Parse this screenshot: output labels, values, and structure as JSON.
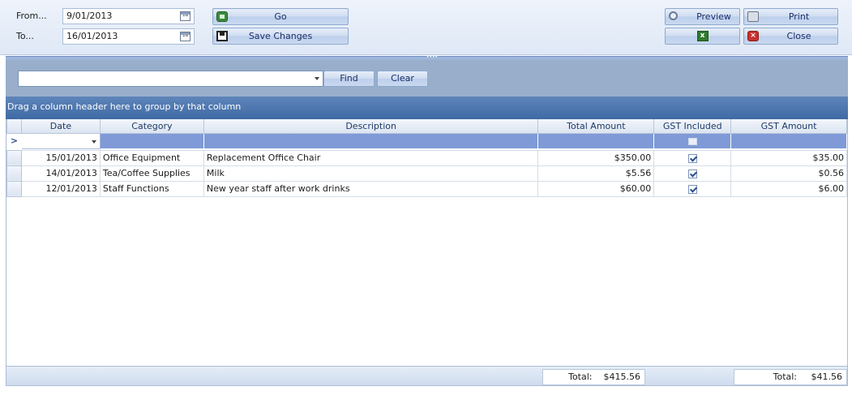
{
  "toolbar": {
    "from_label": "From...",
    "to_label": "To...",
    "from_value": "9/01/2013",
    "to_value": "16/01/2013",
    "calendar_glyph": "18",
    "go_label": "Go",
    "save_label": "Save Changes",
    "preview_label": "Preview",
    "print_label": "Print",
    "close_label": "Close",
    "excel_glyph": "x"
  },
  "search": {
    "value": "",
    "find_label": "Find",
    "clear_label": "Clear"
  },
  "group_panel": {
    "text": "Drag a column header here to group by that column"
  },
  "grid": {
    "columns": [
      "Date",
      "Category",
      "Description",
      "Total Amount",
      "GST Included",
      "GST Amount"
    ],
    "filter_indicator": ">",
    "rows": [
      {
        "date": "15/01/2013",
        "category": "Office Equipment",
        "description": "Replacement Office Chair",
        "total": "$350.00",
        "gst_included": true,
        "gst_amount": "$35.00"
      },
      {
        "date": "14/01/2013",
        "category": "Tea/Coffee Supplies",
        "description": "Milk",
        "total": "$5.56",
        "gst_included": true,
        "gst_amount": "$0.56"
      },
      {
        "date": "12/01/2013",
        "category": "Staff Functions",
        "description": "New year staff after work drinks",
        "total": "$60.00",
        "gst_included": true,
        "gst_amount": "$6.00"
      }
    ]
  },
  "footer": {
    "total_label": "Total:",
    "total_amount": "$415.56",
    "gst_total_label": "Total:",
    "gst_total_amount": "$41.56"
  },
  "colors": {
    "toolbar_bg": "#dfe8f6",
    "group_panel_bg": "#4a74ad",
    "filter_row_bg": "#7f9ad7",
    "button_text": "#1a2c66"
  }
}
